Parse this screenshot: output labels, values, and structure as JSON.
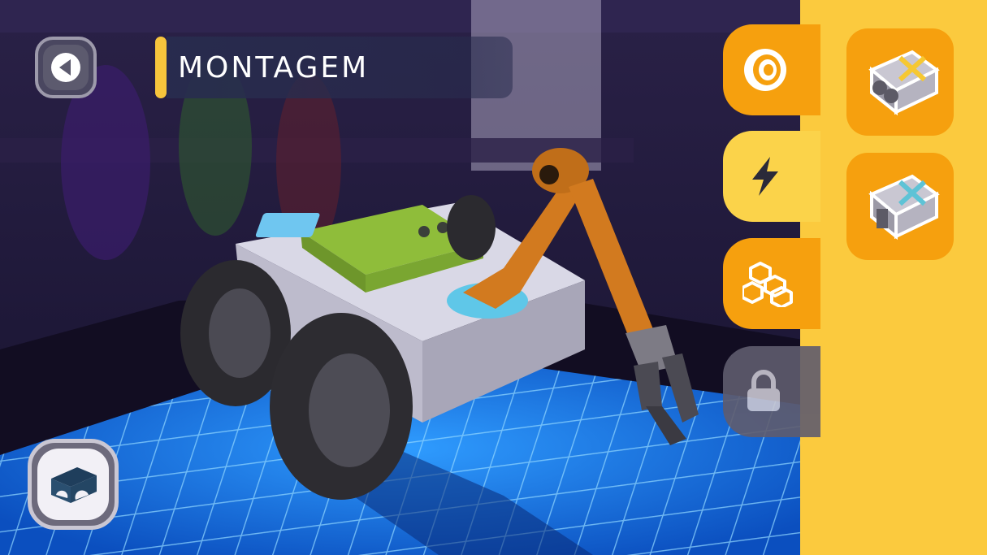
{
  "header": {
    "title": "MONTAGEM"
  },
  "icons": {
    "back": "back-arrow-icon",
    "tabs": [
      "wheel-icon",
      "lightning-icon",
      "blocks-icon",
      "lock-icon"
    ],
    "parts": [
      "sensor-module-icon",
      "motor-module-icon"
    ],
    "home": "garage-icon"
  },
  "colors": {
    "accent_yellow": "#fbca3e",
    "tab_orange": "#f6a00e",
    "tab_selected": "#fbd34a",
    "locked_gray": "#5f5c6e",
    "grid_blue": "#1e7ff0",
    "robot_arm_orange": "#d27a1f",
    "controller_green": "#8fbd3a"
  },
  "selected_tab": "power"
}
